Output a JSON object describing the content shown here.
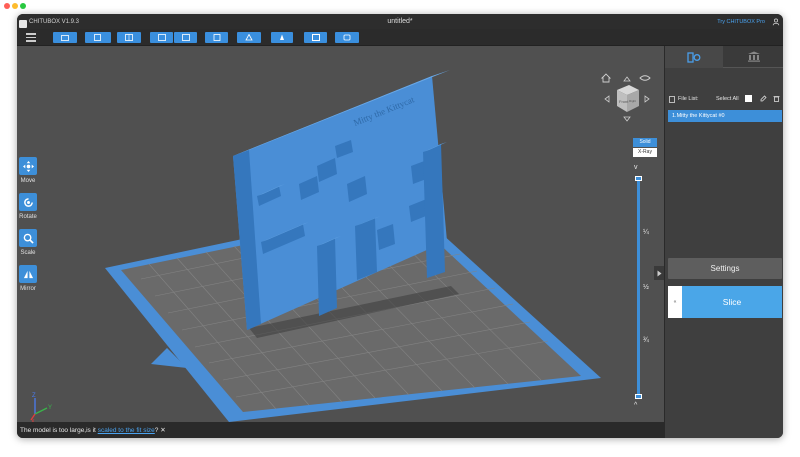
{
  "app": {
    "name": "CHITUBOX V1.9.3",
    "document_title": "untitled*",
    "pro_link": "Try CHITUBOX Pro"
  },
  "toolbar": {
    "buttons": [
      "open-file",
      "save-file",
      "workspace",
      "undo",
      "redo",
      "settings",
      "support",
      "hollow",
      "layout",
      "info"
    ]
  },
  "tools": [
    {
      "label": "Move",
      "icon": "move-icon"
    },
    {
      "label": "Rotate",
      "icon": "rotate-icon"
    },
    {
      "label": "Scale",
      "icon": "scale-icon"
    },
    {
      "label": "Mirror",
      "icon": "mirror-icon"
    }
  ],
  "model": {
    "embossed_text": "Mitty the Kittycat"
  },
  "axes": {
    "x": "X",
    "y": "Y",
    "z": "Z"
  },
  "view": {
    "cube_face": "Front",
    "cube_face_side": "Right",
    "solid_label": "Solid",
    "xray_label": "X-Ray"
  },
  "slider": {
    "marks": [
      "¼",
      "½",
      "¾"
    ],
    "up": "^",
    "down": "v"
  },
  "panel": {
    "file_list_label": "File List:",
    "select_all_label": "Select All",
    "files": [
      "1.Mitty the Kittycat #0"
    ],
    "settings_label": "Settings",
    "slice_label": "Slice",
    "slice_arrow": "«"
  },
  "status": {
    "message_prefix": "The model is too large,is it ",
    "message_link": "scaled to the fit size",
    "message_suffix": "?",
    "close": "✕"
  },
  "colors": {
    "accent": "#3d8fd9",
    "model_blue": "#4a8ed6",
    "platform_gray": "#6b6b6b",
    "viewport_bg": "#505050"
  }
}
